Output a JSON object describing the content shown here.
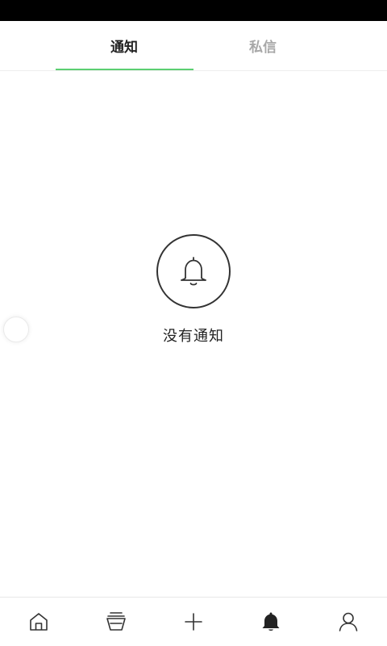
{
  "tabs": [
    {
      "label": "通知",
      "active": true
    },
    {
      "label": "私信",
      "active": false
    }
  ],
  "empty_state": {
    "icon": "bell-outline-icon",
    "message": "没有通知"
  },
  "bottom_nav": [
    {
      "icon": "home-icon",
      "active": false
    },
    {
      "icon": "cup-icon",
      "active": false
    },
    {
      "icon": "plus-icon",
      "active": false
    },
    {
      "icon": "bell-icon",
      "active": true
    },
    {
      "icon": "user-icon",
      "active": false
    }
  ],
  "colors": {
    "accent": "#5ccf72",
    "active_text": "#222222",
    "inactive_text": "#a8a8a8",
    "status_bar": "#000000"
  }
}
